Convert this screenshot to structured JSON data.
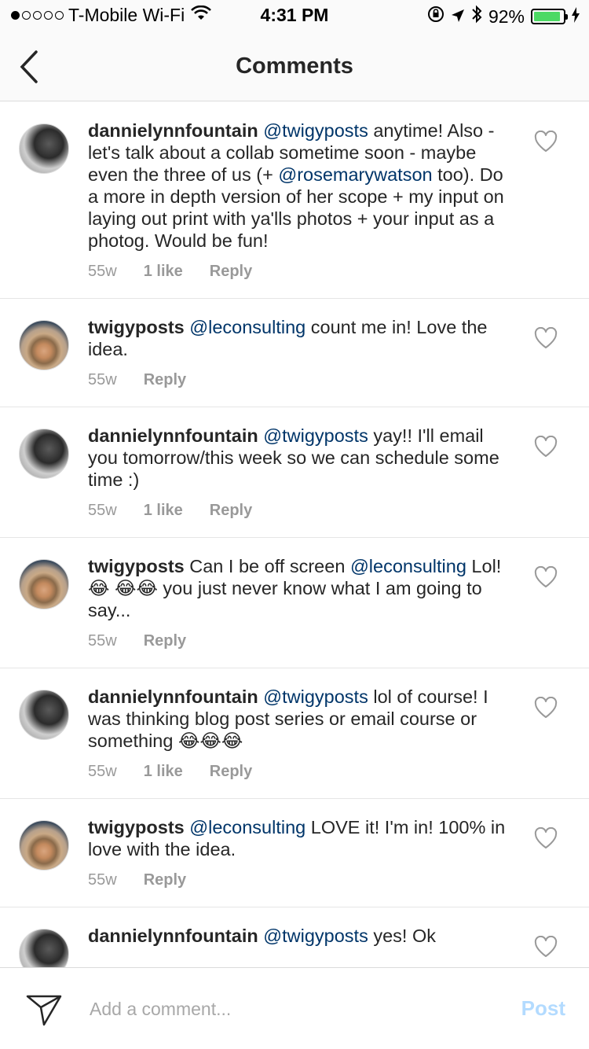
{
  "status_bar": {
    "carrier": "T-Mobile Wi-Fi",
    "time": "4:31 PM",
    "battery_percent": "92%",
    "battery_level": 0.92,
    "icons": [
      "wifi-icon",
      "orientation-lock-icon",
      "location-icon",
      "bluetooth-icon",
      "battery-icon",
      "charging-icon"
    ]
  },
  "nav": {
    "title": "Comments",
    "back_icon": "chevron-left-icon"
  },
  "comments": [
    {
      "username": "dannielynnfountain",
      "mention": "@twigyposts",
      "text_a": " anytime! Also - let's talk about a collab sometime soon - maybe even the three of us (+ ",
      "mention2": "@rosemarywatson",
      "text_b": " too). Do a more in depth version of her scope + my input on laying out print with ya'lls photos + your input as a photog. Would be fun!",
      "time": "55w",
      "likes": "1 like",
      "reply": "Reply",
      "avatar": "bw"
    },
    {
      "username": "twigyposts",
      "mention": "@leconsulting",
      "text_a": " count me in! Love the idea.",
      "time": "55w",
      "reply": "Reply",
      "avatar": "hat"
    },
    {
      "username": "dannielynnfountain",
      "mention": "@twigyposts",
      "text_a": " yay!! I'll email you tomorrow/this week so we can schedule some time :)",
      "time": "55w",
      "likes": "1 like",
      "reply": "Reply",
      "avatar": "bw"
    },
    {
      "username": "twigyposts",
      "text_pre": " Can I be off screen ",
      "mention": "@leconsulting",
      "text_a": " Lol! 😂 😂😂 you just never know what I am going to say...",
      "time": "55w",
      "reply": "Reply",
      "avatar": "hat"
    },
    {
      "username": "dannielynnfountain",
      "mention": "@twigyposts",
      "text_a": " lol of course! I was thinking blog post series or email course or something 😂😂😂",
      "time": "55w",
      "likes": "1 like",
      "reply": "Reply",
      "avatar": "bw"
    },
    {
      "username": "twigyposts",
      "mention": "@leconsulting",
      "text_a": " LOVE it! I'm in! 100% in love with the idea.",
      "time": "55w",
      "reply": "Reply",
      "avatar": "hat"
    },
    {
      "username": "dannielynnfountain",
      "mention": "@twigyposts",
      "text_a": " yes! Ok",
      "avatar": "bw"
    }
  ],
  "composer": {
    "placeholder": "Add a comment...",
    "post_label": "Post",
    "send_icon": "send-icon"
  }
}
